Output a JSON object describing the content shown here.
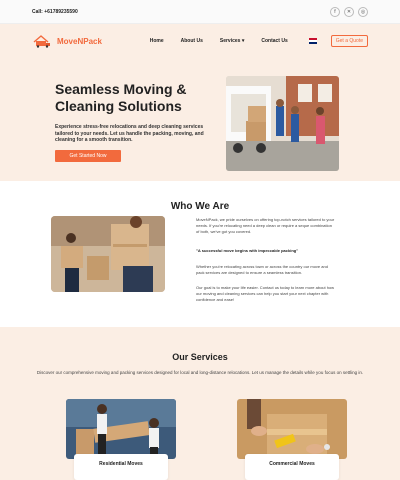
{
  "topbar": {
    "phone": "Call: +61789235590",
    "socials": [
      "facebook-icon",
      "x-icon",
      "instagram-icon"
    ]
  },
  "header": {
    "brand": "MoveNPack",
    "nav": [
      {
        "label": "Home"
      },
      {
        "label": "About Us"
      },
      {
        "label": "Services ▾"
      },
      {
        "label": "Contact Us"
      }
    ],
    "quote_label": "Get a Quote"
  },
  "hero": {
    "title": "Seamless Moving & Cleaning Solutions",
    "subtitle": "Experience stress-free relocations and deep cleaning services tailored to your needs. Let us handle the packing, moving, and cleaning for a smooth transition.",
    "cta": "Get Started Now"
  },
  "about": {
    "title": "Who We Are",
    "p1": "MoveNPack, we pride ourselves on offering top-notch services tailored to your needs. If you're relocating need a deep clean or require a seque combination of both, we've got you covered.",
    "quote": "\"A successful move begins with impeccable packing\"",
    "p2": "Whether you're relocating across town or across the country our move and pack services are designed to ensure a seamless transition.",
    "p3": "Our goal is to make your life easier. Contact us today to learn more about how our moving and cleaning services can help you start your next chapter with confidence and ease!"
  },
  "services": {
    "title": "Our Services",
    "subtitle": "Discover our comprehensive moving and packing services designed for local and long-distance relocations. Let us manage the details while you focus on settling in.",
    "cards": [
      {
        "label": "Residential Moves"
      },
      {
        "label": "Commercial Moves"
      }
    ]
  },
  "colors": {
    "accent": "#f26a3d",
    "section_bg": "#fbeee4"
  }
}
